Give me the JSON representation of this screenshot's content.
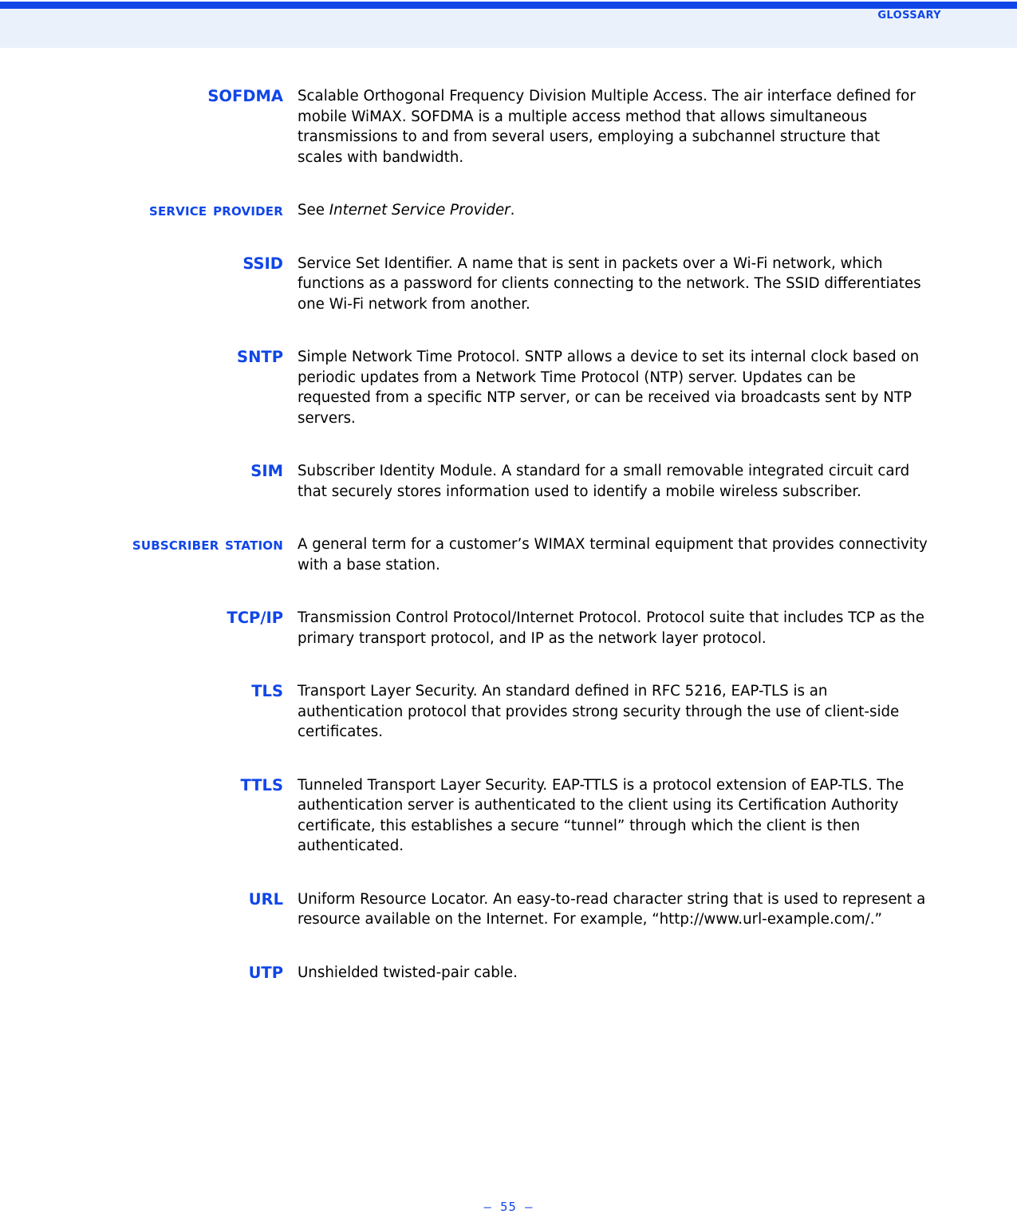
{
  "header": {
    "title": "Glossary",
    "rule_color": "#1046e8",
    "band_color": "#eaf1fb"
  },
  "accent_color": "#1046e8",
  "glossary": {
    "entries": [
      {
        "term": "SOFDMA",
        "term_style": "uppercase",
        "definition": "Scalable Orthogonal Frequency Division Multiple Access. The air interface defined for mobile WiMAX. SOFDMA is a multiple access method that allows simultaneous transmissions to and from several users, employing a subchannel structure that scales with bandwidth."
      },
      {
        "term": "Service Provider",
        "term_style": "smallcaps",
        "definition_prefix": "See ",
        "definition_italic": "Internet Service Provider",
        "definition_suffix": ".",
        "definition": "See Internet Service Provider."
      },
      {
        "term": "SSID",
        "term_style": "uppercase",
        "definition": "Service Set Identifier. A name that is sent in packets over a Wi-Fi network, which functions as a password for clients connecting to the network. The SSID differentiates one Wi-Fi network from another."
      },
      {
        "term": "SNTP",
        "term_style": "uppercase",
        "definition": "Simple Network Time Protocol. SNTP allows a device to set its internal clock based on periodic updates from a Network Time Protocol (NTP) server. Updates can be requested from a specific NTP server, or can be received via broadcasts sent by NTP servers."
      },
      {
        "term": "SIM",
        "term_style": "uppercase",
        "definition": "Subscriber Identity Module. A standard for a small removable integrated circuit card that securely stores information used to identify a mobile wireless subscriber."
      },
      {
        "term": "Subscriber Station",
        "term_style": "smallcaps",
        "definition": "A general term for a customer’s WIMAX terminal equipment that provides connectivity with a base station."
      },
      {
        "term": "TCP/IP",
        "term_style": "uppercase",
        "definition": "Transmission Control Protocol/Internet Protocol. Protocol suite that includes TCP as the primary transport protocol, and IP as the network layer protocol."
      },
      {
        "term": "TLS",
        "term_style": "uppercase",
        "definition": "Transport Layer Security. An standard defined in RFC 5216, EAP-TLS is an authentication protocol that provides strong security through the use of client-side certificates."
      },
      {
        "term": "TTLS",
        "term_style": "uppercase",
        "definition": "Tunneled Transport Layer Security. EAP-TTLS is a protocol extension of EAP-TLS. The authentication server is authenticated to the client using its Certification Authority certificate, this establishes a secure “tunnel” through which the client is then authenticated."
      },
      {
        "term": "URL",
        "term_style": "uppercase",
        "definition": "Uniform Resource Locator. An easy-to-read character string that is used to represent a resource available on the Internet. For example, “http://www.url-example.com/.”"
      },
      {
        "term": "UTP",
        "term_style": "uppercase",
        "definition": "Unshielded twisted-pair cable."
      }
    ]
  },
  "footer": {
    "page_number": "–  55  –"
  }
}
